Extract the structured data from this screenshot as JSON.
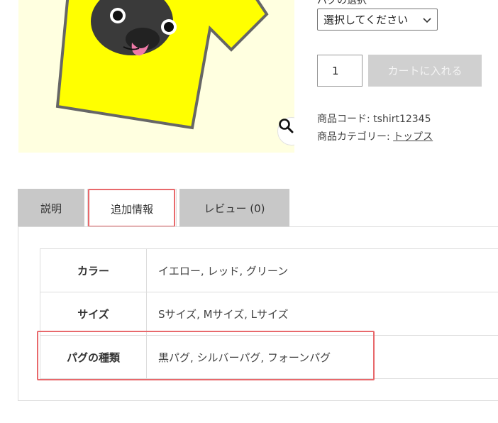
{
  "variation": {
    "label": "パグの選択",
    "select_value": "選択してください"
  },
  "quantity": {
    "value": "1"
  },
  "cart_button": {
    "label": "カートに入れる"
  },
  "meta": {
    "sku_label": "商品コード: ",
    "sku_value": "tshirt12345",
    "category_label": "商品カテゴリー: ",
    "category_value": "トップス"
  },
  "tabs": [
    {
      "label": "説明"
    },
    {
      "label": "追加情報"
    },
    {
      "label": "レビュー (0)"
    }
  ],
  "attributes": [
    {
      "name": "カラー",
      "value": "イエロー, レッド, グリーン"
    },
    {
      "name": "サイズ",
      "value": "Sサイズ, Mサイズ, Lサイズ"
    },
    {
      "name": "パグの種類",
      "value": "黒パグ, シルバーパグ, フォーンパグ"
    }
  ],
  "colors": {
    "highlight": "#e8696c",
    "tshirt": "#ffff00",
    "image_bg": "#ffffe0",
    "disabled_button": "#d0d0d0"
  },
  "icons": {
    "zoom": "magnifier-icon",
    "select": "chevron-down-icon"
  }
}
